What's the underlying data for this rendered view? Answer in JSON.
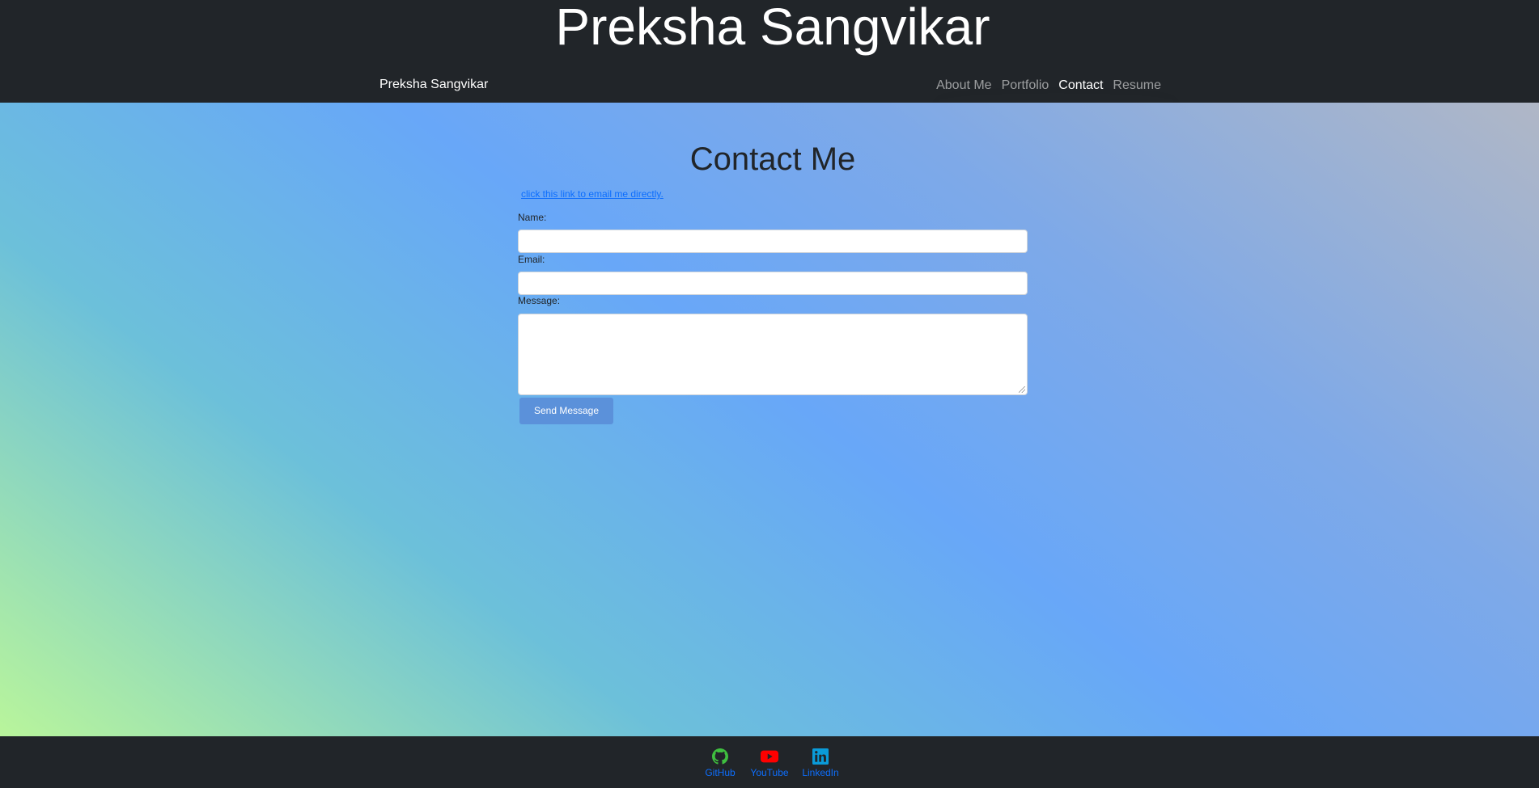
{
  "header": {
    "title": "Preksha Sangvikar"
  },
  "navbar": {
    "brand": "Preksha Sangvikar",
    "links": [
      {
        "label": "About Me",
        "active": false
      },
      {
        "label": "Portfolio",
        "active": false
      },
      {
        "label": "Contact",
        "active": true
      },
      {
        "label": "Resume",
        "active": false
      }
    ]
  },
  "contact": {
    "title": "Contact Me",
    "email_link": "click this link to email me directly.",
    "name_label": "Name:",
    "name_value": "",
    "email_label": "Email:",
    "email_value": "",
    "message_label": "Message:",
    "message_value": "",
    "send_button": "Send Message"
  },
  "footer": {
    "socials": [
      {
        "label": "GitHub",
        "icon": "github-icon",
        "color": "#3fbf3f"
      },
      {
        "label": "YouTube",
        "icon": "youtube-icon",
        "color": "#ff0000"
      },
      {
        "label": "LinkedIn",
        "icon": "linkedin-icon",
        "color": "#0a9bd8"
      }
    ]
  },
  "colors": {
    "header_bg": "#212529",
    "link": "#0d6efd",
    "button_bg": "#5b91da"
  }
}
